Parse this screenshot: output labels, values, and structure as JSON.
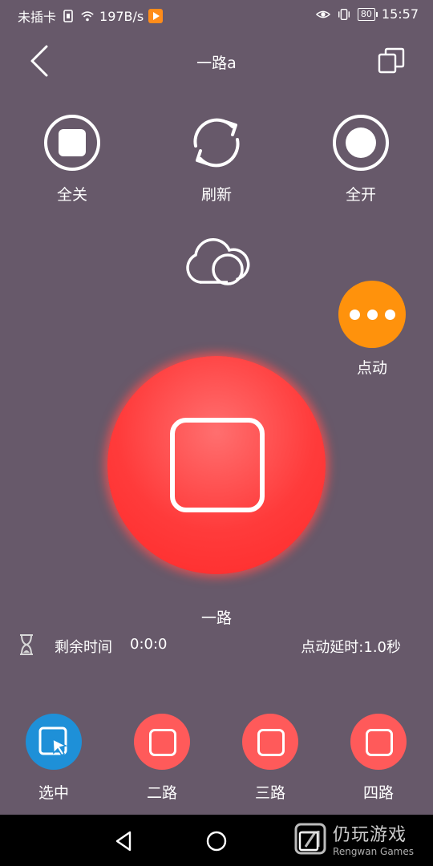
{
  "status_bar": {
    "carrier": "未插卡",
    "speed": "197B/s",
    "battery": "80",
    "time": "15:57"
  },
  "header": {
    "title": "一路a"
  },
  "actions": {
    "all_off": "全关",
    "refresh": "刷新",
    "all_on": "全开"
  },
  "jog": {
    "label": "点动"
  },
  "main": {
    "channel_name": "一路",
    "remaining_label": "剩余时间",
    "remaining_value": "0:0:0",
    "jog_delay": "点动延时:1.0秒"
  },
  "channels": [
    {
      "label": "选中",
      "selected": true
    },
    {
      "label": "二路"
    },
    {
      "label": "三路"
    },
    {
      "label": "四路"
    }
  ],
  "watermark": {
    "name": "仍玩游戏",
    "sub": "Rengwan Games"
  },
  "colors": {
    "background": "#67596a",
    "accent_red": "#ff5a5a",
    "accent_orange": "#ff920c",
    "accent_blue": "#1e90d8"
  }
}
